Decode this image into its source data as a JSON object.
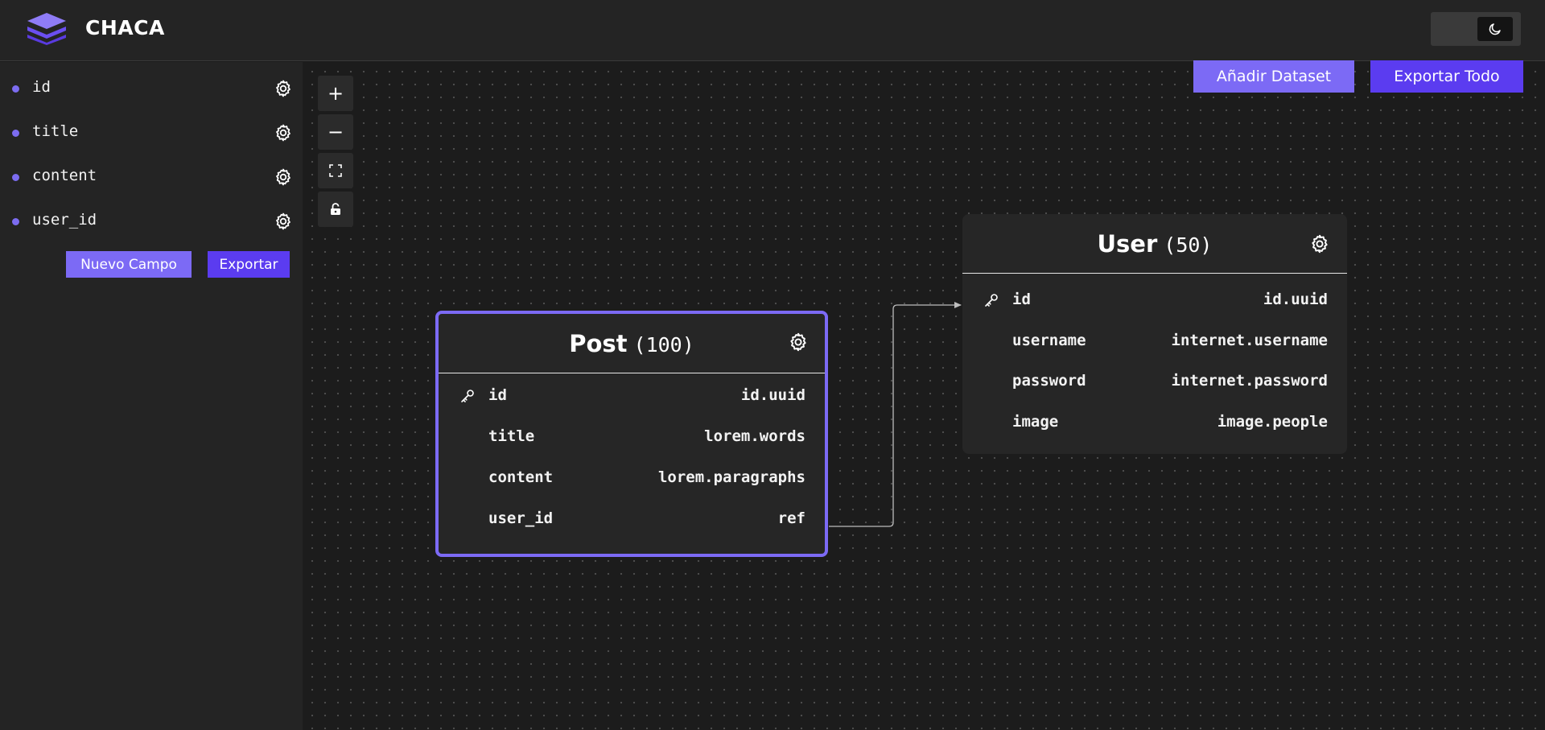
{
  "app": {
    "title": "CHACA",
    "accent_color": "#7c6af5",
    "accent_dark_color": "#5b3cf0"
  },
  "header": {
    "theme_toggle_icon": "moon-icon"
  },
  "sidebar": {
    "fields": [
      {
        "label": "id",
        "icon": "gear-icon"
      },
      {
        "label": "title",
        "icon": "gear-icon"
      },
      {
        "label": "content",
        "icon": "gear-icon"
      },
      {
        "label": "user_id",
        "icon": "gear-icon"
      }
    ],
    "new_field_label": "Nuevo Campo",
    "export_label": "Exportar"
  },
  "canvas": {
    "zoom_controls": [
      {
        "symbol": "+",
        "icon": "plus-icon"
      },
      {
        "symbol": "−",
        "icon": "minus-icon"
      },
      {
        "symbol": "",
        "icon": "fit-view-icon"
      },
      {
        "symbol": "",
        "icon": "lock-icon"
      }
    ],
    "add_dataset_label": "Añadir Dataset",
    "export_all_label": "Exportar Todo"
  },
  "datasets": {
    "post": {
      "name": "Post",
      "count": "(100)",
      "fields": [
        {
          "name": "id",
          "type": "id.uuid",
          "key": true
        },
        {
          "name": "title",
          "type": "lorem.words",
          "key": false
        },
        {
          "name": "content",
          "type": "lorem.paragraphs",
          "key": false
        },
        {
          "name": "user_id",
          "type": "ref",
          "key": false
        }
      ]
    },
    "user": {
      "name": "User",
      "count": "(50)",
      "fields": [
        {
          "name": "id",
          "type": "id.uuid",
          "key": true
        },
        {
          "name": "username",
          "type": "internet.username",
          "key": false
        },
        {
          "name": "password",
          "type": "internet.password",
          "key": false
        },
        {
          "name": "image",
          "type": "image.people",
          "key": false
        }
      ]
    }
  }
}
